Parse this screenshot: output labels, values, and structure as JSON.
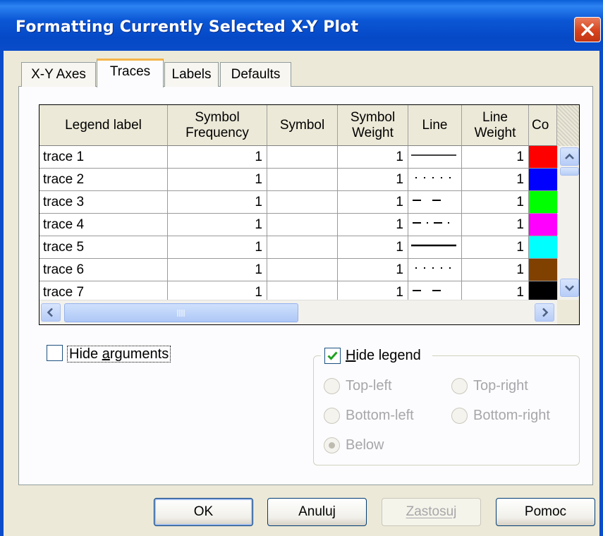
{
  "window": {
    "title": "Formatting Currently Selected X-Y Plot"
  },
  "tabs": [
    {
      "label": "X-Y Axes",
      "active": false
    },
    {
      "label": "Traces",
      "active": true
    },
    {
      "label": "Labels",
      "active": false
    },
    {
      "label": "Defaults",
      "active": false
    }
  ],
  "grid": {
    "columns": [
      "Legend label",
      "Symbol\nFrequency",
      "Symbol",
      "Symbol\nWeight",
      "Line",
      "Line\nWeight",
      "Co"
    ],
    "rows": [
      {
        "label": "trace 1",
        "symbol_frequency": "1",
        "symbol": "",
        "symbol_weight": "1",
        "line_style": "solid",
        "line_weight": "1",
        "color": "#ff0000"
      },
      {
        "label": "trace 2",
        "symbol_frequency": "1",
        "symbol": "",
        "symbol_weight": "1",
        "line_style": "dot",
        "line_weight": "1",
        "color": "#0000ff"
      },
      {
        "label": "trace 3",
        "symbol_frequency": "1",
        "symbol": "",
        "symbol_weight": "1",
        "line_style": "dash",
        "line_weight": "1",
        "color": "#00ff00"
      },
      {
        "label": "trace 4",
        "symbol_frequency": "1",
        "symbol": "",
        "symbol_weight": "1",
        "line_style": "dashdot",
        "line_weight": "1",
        "color": "#ff00ff"
      },
      {
        "label": "trace 5",
        "symbol_frequency": "1",
        "symbol": "",
        "symbol_weight": "1",
        "line_style": "solid-thick",
        "line_weight": "1",
        "color": "#00ffff"
      },
      {
        "label": "trace 6",
        "symbol_frequency": "1",
        "symbol": "",
        "symbol_weight": "1",
        "line_style": "dot",
        "line_weight": "1",
        "color": "#804000"
      },
      {
        "label": "trace 7",
        "symbol_frequency": "1",
        "symbol": "",
        "symbol_weight": "1",
        "line_style": "dash",
        "line_weight": "1",
        "color": "#000000"
      }
    ]
  },
  "options": {
    "hide_arguments": {
      "label": "Hide arguments",
      "checked": false
    },
    "hide_legend": {
      "label": "Hide legend",
      "checked": true
    },
    "legend_position": {
      "selected": "Below",
      "options": [
        "Top-left",
        "Top-right",
        "Bottom-left",
        "Bottom-right",
        "Below"
      ]
    }
  },
  "buttons": {
    "ok": "OK",
    "cancel": "Anuluj",
    "apply": "Zastosuj",
    "help": "Pomoc"
  },
  "icons": {
    "close": "close-x-icon",
    "checkmark": "checkmark-icon",
    "scroll_up": "chevron-up-icon",
    "scroll_down": "chevron-down-icon",
    "scroll_left": "chevron-left-icon",
    "scroll_right": "chevron-right-icon"
  }
}
